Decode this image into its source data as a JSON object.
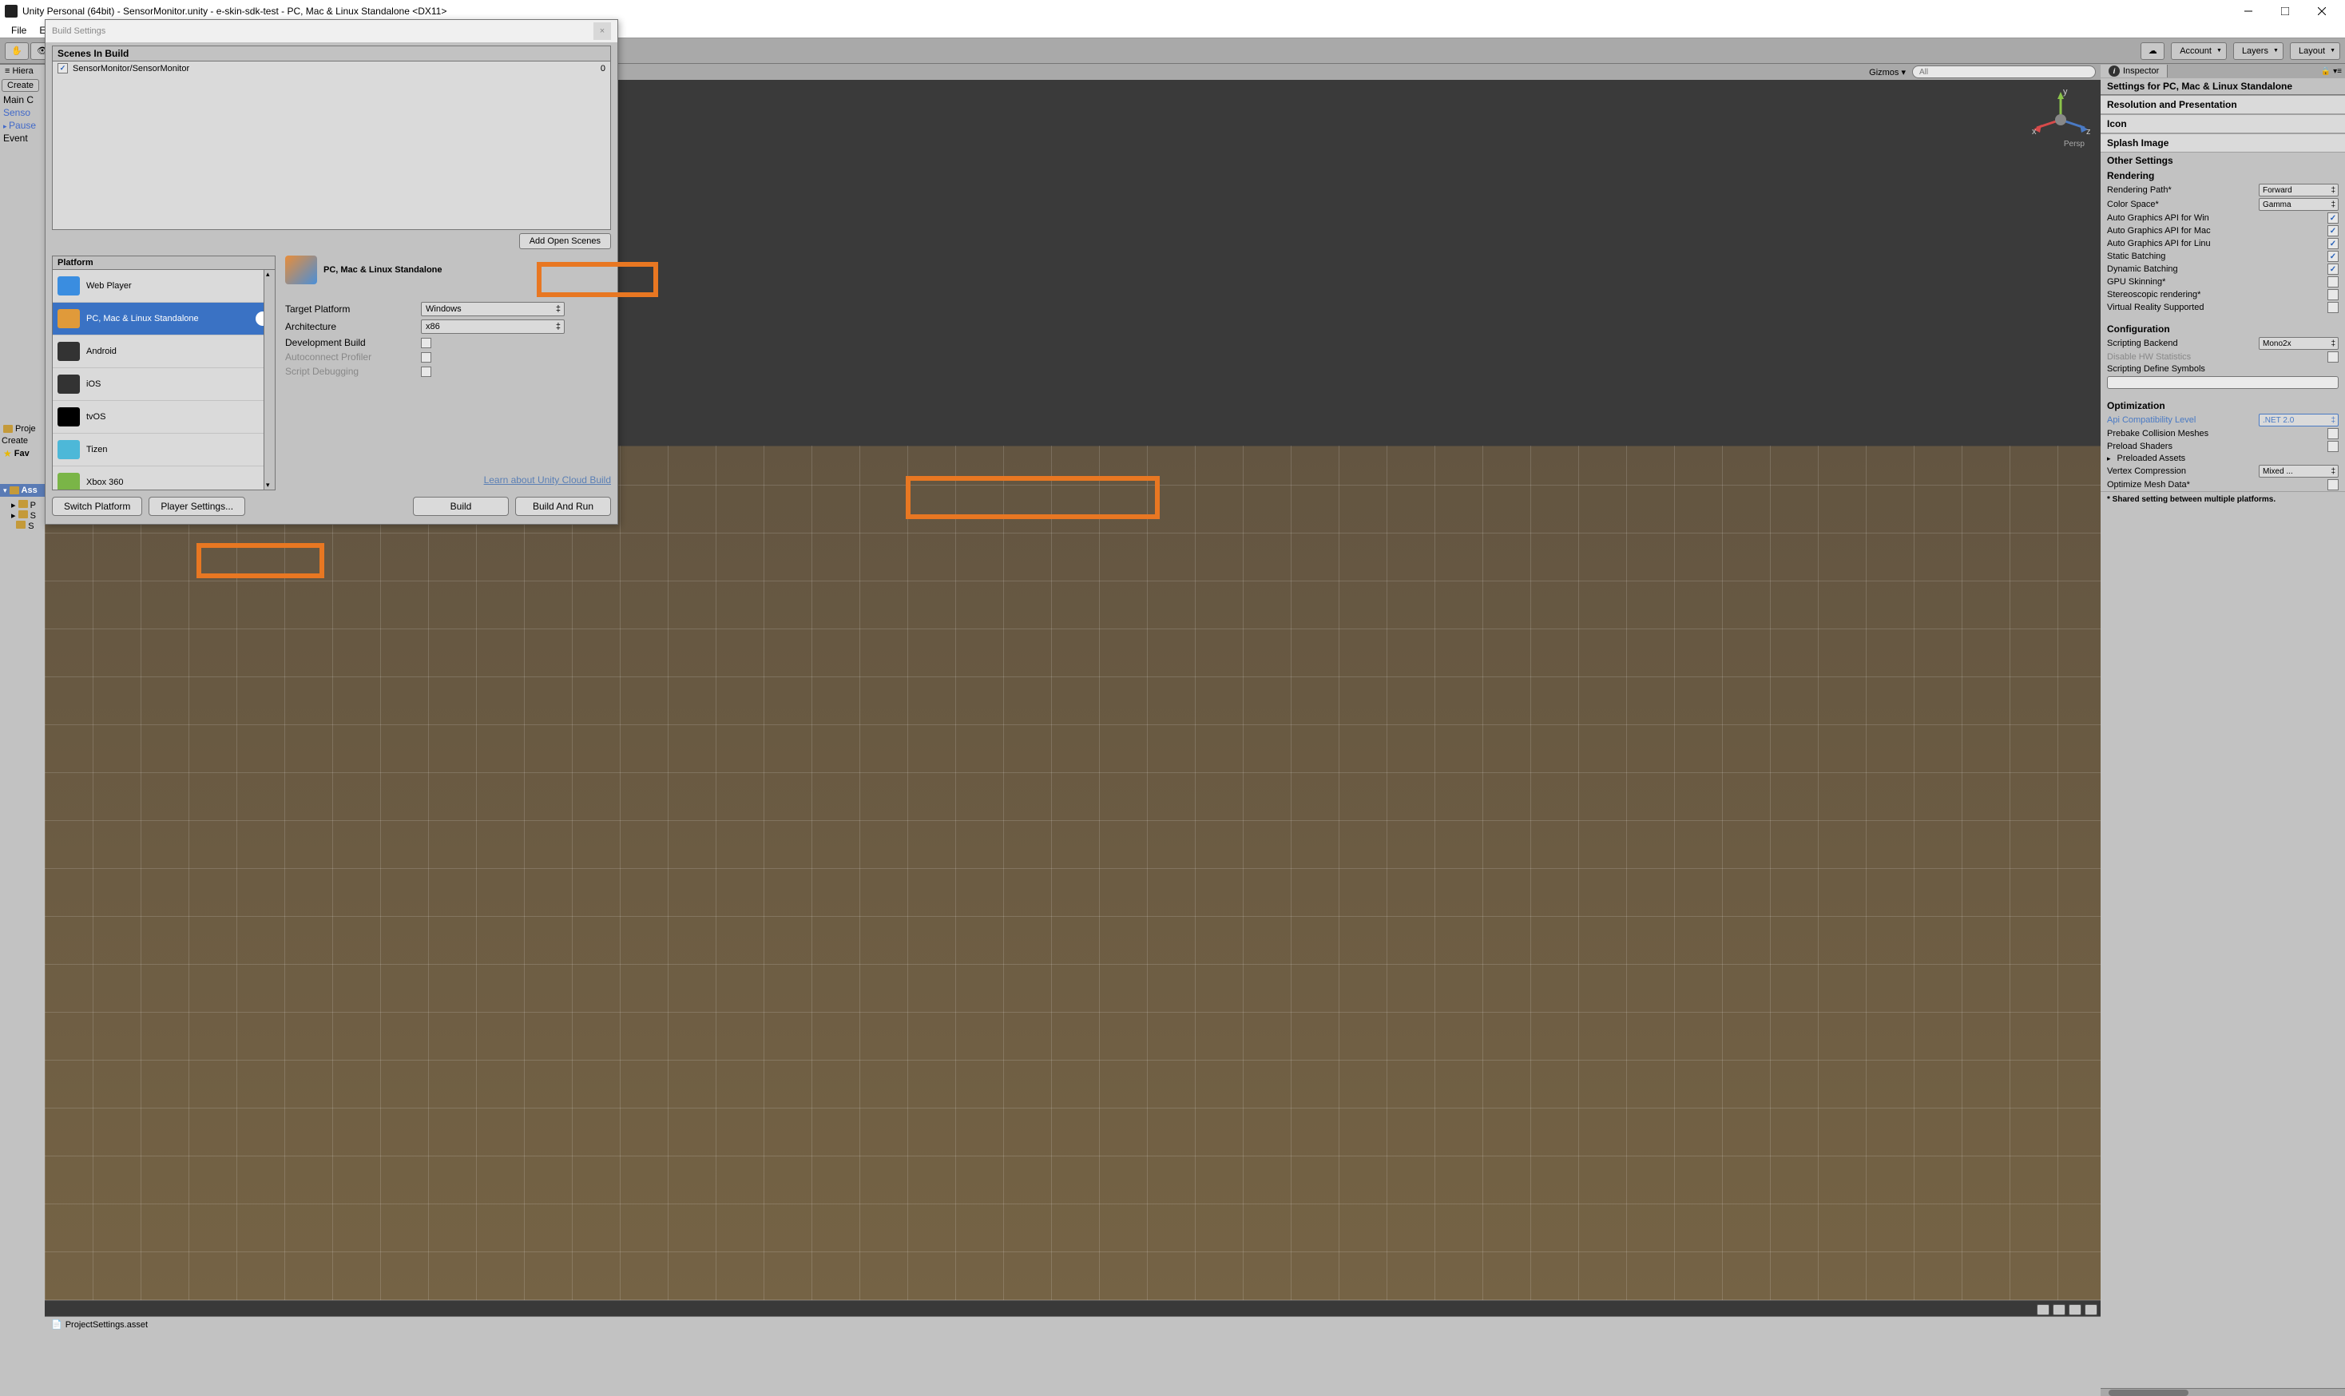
{
  "window": {
    "title": "Unity Personal (64bit) - SensorMonitor.unity - e-skin-sdk-test - PC, Mac & Linux Standalone <DX11>"
  },
  "menubar": [
    "File",
    "Ed"
  ],
  "toolbar": {
    "account": "Account",
    "layers": "Layers",
    "layout": "Layout"
  },
  "hierarchy": {
    "tab": "Hiera",
    "create": "Create",
    "items": [
      {
        "label": "Main C",
        "link": false
      },
      {
        "label": "Senso",
        "link": true
      },
      {
        "label": "Pause",
        "link": true,
        "arrow": true
      },
      {
        "label": "Event",
        "link": false
      }
    ]
  },
  "project": {
    "tab": "Proje",
    "create": "Create",
    "fav": "Fav",
    "assets": "Ass",
    "rows": [
      "P",
      "S",
      "S"
    ]
  },
  "scene": {
    "gizmos": "Gizmos",
    "search_placeholder": "All",
    "persp": "Persp",
    "axes": {
      "x": "x",
      "y": "y",
      "z": "z"
    }
  },
  "statusbar": {
    "file": "ProjectSettings.asset"
  },
  "inspector": {
    "tab": "Inspector",
    "header": "Settings for PC, Mac & Linux Standalone",
    "sections": {
      "resolution": "Resolution and Presentation",
      "icon": "Icon",
      "splash": "Splash Image",
      "other": "Other Settings"
    },
    "rendering": {
      "title": "Rendering",
      "rows": [
        {
          "label": "Rendering Path*",
          "type": "select",
          "value": "Forward"
        },
        {
          "label": "Color Space*",
          "type": "select",
          "value": "Gamma"
        },
        {
          "label": "Auto Graphics API for Win",
          "type": "check",
          "checked": true
        },
        {
          "label": "Auto Graphics API for Mac",
          "type": "check",
          "checked": true
        },
        {
          "label": "Auto Graphics API for Linu",
          "type": "check",
          "checked": true
        },
        {
          "label": "Static Batching",
          "type": "check",
          "checked": true
        },
        {
          "label": "Dynamic Batching",
          "type": "check",
          "checked": true
        },
        {
          "label": "GPU Skinning*",
          "type": "check",
          "checked": false
        },
        {
          "label": "Stereoscopic rendering*",
          "type": "check",
          "checked": false
        },
        {
          "label": "Virtual Reality Supported",
          "type": "check",
          "checked": false
        }
      ]
    },
    "configuration": {
      "title": "Configuration",
      "rows": [
        {
          "label": "Scripting Backend",
          "type": "select",
          "value": "Mono2x"
        },
        {
          "label": "Disable HW Statistics",
          "type": "check",
          "checked": false,
          "disabled": true
        },
        {
          "label": "Scripting Define Symbols",
          "type": "textfield"
        }
      ]
    },
    "optimization": {
      "title": "Optimization",
      "rows": [
        {
          "label": "Api Compatibility Level",
          "type": "select",
          "value": ".NET 2.0",
          "highlight": true
        },
        {
          "label": "Prebake Collision Meshes",
          "type": "check",
          "checked": false
        },
        {
          "label": "Preload Shaders",
          "type": "check",
          "checked": false
        },
        {
          "label": "Preloaded Assets",
          "type": "expand"
        },
        {
          "label": "Vertex Compression",
          "type": "select",
          "value": "Mixed ..."
        },
        {
          "label": "Optimize Mesh Data*",
          "type": "check",
          "checked": false
        }
      ]
    },
    "note": "* Shared setting between multiple platforms."
  },
  "build_dialog": {
    "title": "Build Settings",
    "scenes_header": "Scenes In Build",
    "scenes": [
      {
        "name": "SensorMonitor/SensorMonitor",
        "checked": true,
        "index": "0"
      }
    ],
    "add_open_scenes": "Add Open Scenes",
    "platform_header": "Platform",
    "platforms": [
      {
        "name": "Web Player",
        "selected": false,
        "icon_bg": "#3a8de0"
      },
      {
        "name": "PC, Mac & Linux Standalone",
        "selected": true,
        "badge": true,
        "icon_bg": "#e09a3a"
      },
      {
        "name": "Android",
        "selected": false,
        "icon_bg": "#333"
      },
      {
        "name": "iOS",
        "selected": false,
        "icon_bg": "#333"
      },
      {
        "name": "tvOS",
        "selected": false,
        "icon_bg": "#000"
      },
      {
        "name": "Tizen",
        "selected": false,
        "icon_bg": "#4db8d8"
      },
      {
        "name": "Xbox 360",
        "selected": false,
        "icon_bg": "#7ab547"
      }
    ],
    "current_platform": "PC, Mac & Linux Standalone",
    "options": [
      {
        "label": "Target Platform",
        "type": "select",
        "value": "Windows"
      },
      {
        "label": "Architecture",
        "type": "select",
        "value": "x86"
      },
      {
        "label": "Development Build",
        "type": "check",
        "checked": false
      },
      {
        "label": "Autoconnect Profiler",
        "type": "check",
        "checked": false,
        "disabled": true
      },
      {
        "label": "Script Debugging",
        "type": "check",
        "checked": false,
        "disabled": true
      }
    ],
    "cloud_link": "Learn about Unity Cloud Build",
    "switch_platform": "Switch Platform",
    "player_settings": "Player Settings...",
    "build": "Build",
    "build_and_run": "Build And Run"
  }
}
